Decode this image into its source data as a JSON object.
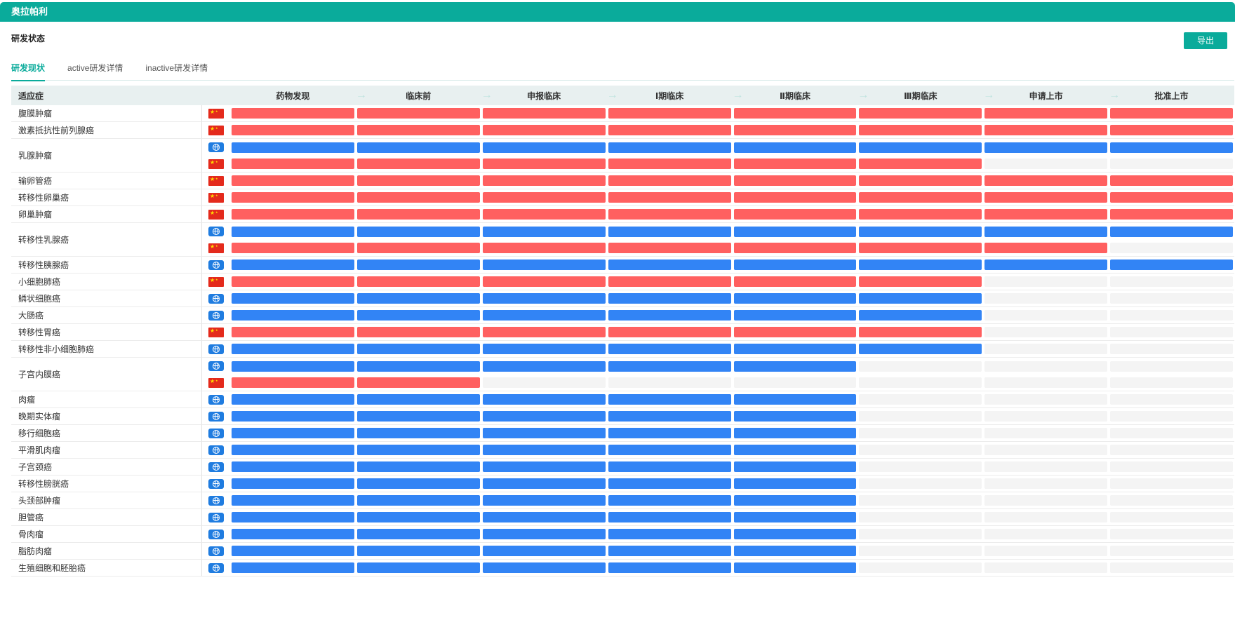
{
  "app": {
    "title": "奥拉帕利"
  },
  "header": {
    "section_title": "研发状态",
    "export_label": "导出"
  },
  "tabs": [
    {
      "label": "研发现状",
      "active": true
    },
    {
      "label": "active研发详情",
      "active": false
    },
    {
      "label": "inactive研发详情",
      "active": false
    }
  ],
  "table": {
    "indication_header": "适应症",
    "stages": [
      "药物发现",
      "临床前",
      "申报临床",
      "Ⅰ期临床",
      "Ⅱ期临床",
      "Ⅲ期临床",
      "申请上市",
      "批准上市"
    ],
    "regions": {
      "china": "china-flag-icon",
      "global": "globe-icon"
    },
    "colors": {
      "china": "#ff6060",
      "global": "#3284f5",
      "empty": "#f4f4f4",
      "accent": "#0aab9b"
    },
    "rows": [
      {
        "name": "腹膜肿瘤",
        "entries": [
          {
            "region": "china",
            "stages_reached": 8
          }
        ]
      },
      {
        "name": "激素抵抗性前列腺癌",
        "entries": [
          {
            "region": "china",
            "stages_reached": 8
          }
        ]
      },
      {
        "name": "乳腺肿瘤",
        "entries": [
          {
            "region": "global",
            "stages_reached": 8
          },
          {
            "region": "china",
            "stages_reached": 6
          }
        ]
      },
      {
        "name": "输卵管癌",
        "entries": [
          {
            "region": "china",
            "stages_reached": 8
          }
        ]
      },
      {
        "name": "转移性卵巢癌",
        "entries": [
          {
            "region": "china",
            "stages_reached": 8
          }
        ]
      },
      {
        "name": "卵巢肿瘤",
        "entries": [
          {
            "region": "china",
            "stages_reached": 8
          }
        ]
      },
      {
        "name": "转移性乳腺癌",
        "entries": [
          {
            "region": "global",
            "stages_reached": 8
          },
          {
            "region": "china",
            "stages_reached": 7
          }
        ]
      },
      {
        "name": "转移性胰腺癌",
        "entries": [
          {
            "region": "global",
            "stages_reached": 8
          }
        ]
      },
      {
        "name": "小细胞肺癌",
        "entries": [
          {
            "region": "china",
            "stages_reached": 6
          }
        ]
      },
      {
        "name": "鳞状细胞癌",
        "entries": [
          {
            "region": "global",
            "stages_reached": 6
          }
        ]
      },
      {
        "name": "大肠癌",
        "entries": [
          {
            "region": "global",
            "stages_reached": 6
          }
        ]
      },
      {
        "name": "转移性胃癌",
        "entries": [
          {
            "region": "china",
            "stages_reached": 6
          }
        ]
      },
      {
        "name": "转移性非小细胞肺癌",
        "entries": [
          {
            "region": "global",
            "stages_reached": 6
          }
        ]
      },
      {
        "name": "子宫内膜癌",
        "entries": [
          {
            "region": "global",
            "stages_reached": 5
          },
          {
            "region": "china",
            "stages_reached": 2
          }
        ]
      },
      {
        "name": "肉瘤",
        "entries": [
          {
            "region": "global",
            "stages_reached": 5
          }
        ]
      },
      {
        "name": "晚期实体瘤",
        "entries": [
          {
            "region": "global",
            "stages_reached": 5
          }
        ]
      },
      {
        "name": "移行细胞癌",
        "entries": [
          {
            "region": "global",
            "stages_reached": 5
          }
        ]
      },
      {
        "name": "平滑肌肉瘤",
        "entries": [
          {
            "region": "global",
            "stages_reached": 5
          }
        ]
      },
      {
        "name": "子宫颈癌",
        "entries": [
          {
            "region": "global",
            "stages_reached": 5
          }
        ]
      },
      {
        "name": "转移性膀胱癌",
        "entries": [
          {
            "region": "global",
            "stages_reached": 5
          }
        ]
      },
      {
        "name": "头颈部肿瘤",
        "entries": [
          {
            "region": "global",
            "stages_reached": 5
          }
        ]
      },
      {
        "name": "胆管癌",
        "entries": [
          {
            "region": "global",
            "stages_reached": 5
          }
        ]
      },
      {
        "name": "骨肉瘤",
        "entries": [
          {
            "region": "global",
            "stages_reached": 5
          }
        ]
      },
      {
        "name": "脂肪肉瘤",
        "entries": [
          {
            "region": "global",
            "stages_reached": 5
          }
        ]
      },
      {
        "name": "生殖细胞和胚胎癌",
        "entries": [
          {
            "region": "global",
            "stages_reached": 5
          }
        ]
      }
    ]
  }
}
